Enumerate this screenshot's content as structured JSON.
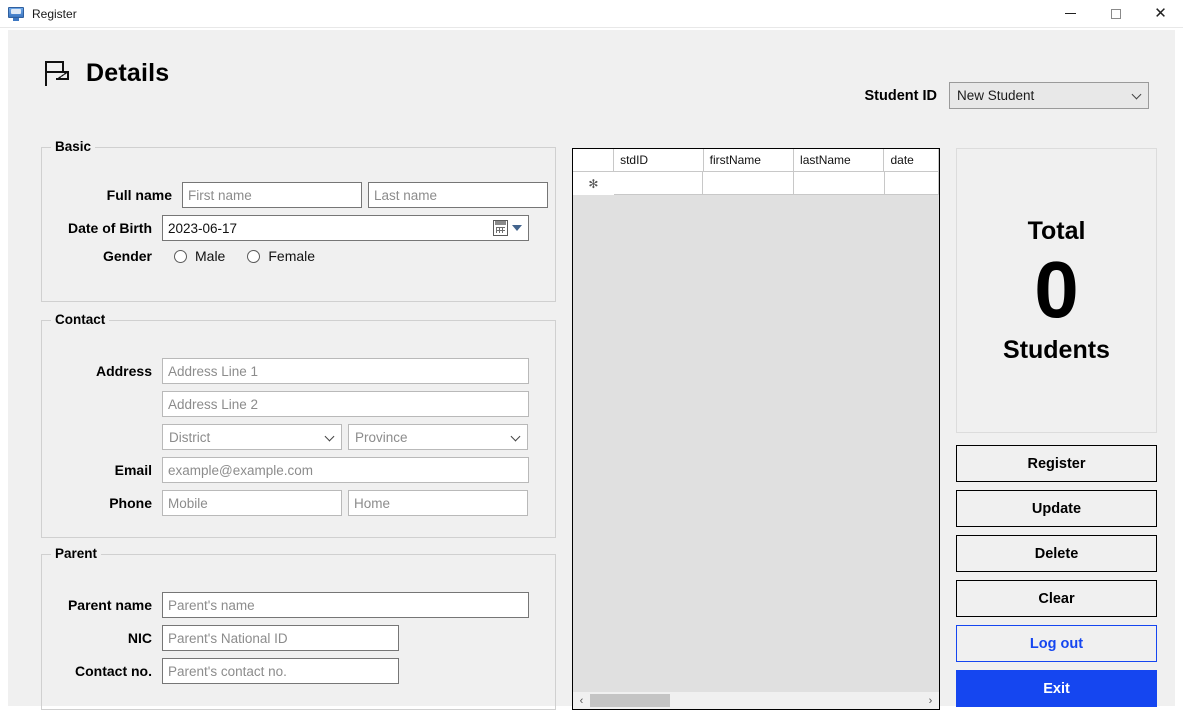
{
  "titlebar": {
    "title": "Register",
    "icon": "monitor-icon",
    "minimize": "–",
    "maximize": "□",
    "close": "✕"
  },
  "header": {
    "icon": "flag-icon",
    "title": "Details",
    "student_id_label": "Student ID",
    "student_id_value": "New Student"
  },
  "basic": {
    "group_title": "Basic",
    "full_name_label": "Full name",
    "first_name_placeholder": "First name",
    "last_name_placeholder": "Last name",
    "dob_label": "Date of Birth",
    "dob_value": "2023-06-17",
    "gender_label": "Gender",
    "gender_male": "Male",
    "gender_female": "Female"
  },
  "contact": {
    "group_title": "Contact",
    "address_label": "Address",
    "address1_placeholder": "Address Line 1",
    "address2_placeholder": "Address Line 2",
    "district_placeholder": "District",
    "province_placeholder": "Province",
    "email_label": "Email",
    "email_placeholder": "example@example.com",
    "phone_label": "Phone",
    "mobile_placeholder": "Mobile",
    "home_placeholder": "Home"
  },
  "parent": {
    "group_title": "Parent",
    "name_label": "Parent name",
    "name_placeholder": "Parent's name",
    "nic_label": "NIC",
    "nic_placeholder": "Parent's National ID",
    "contact_label": "Contact no.",
    "contact_placeholder": "Parent's contact no."
  },
  "grid": {
    "columns": [
      "stdID",
      "firstName",
      "lastName",
      "date"
    ],
    "new_row_marker": "✻",
    "rows": [],
    "scroll_left_arrow": "‹",
    "scroll_right_arrow": "›"
  },
  "total_card": {
    "top_label": "Total",
    "count": "0",
    "bottom_label": "Students"
  },
  "buttons": {
    "register": "Register",
    "update": "Update",
    "delete": "Delete",
    "clear": "Clear",
    "logout": "Log out",
    "exit": "Exit"
  },
  "colors": {
    "accent_blue": "#1546f0",
    "form_background": "#f0f0f0",
    "grid_background": "#e0e0e0"
  }
}
